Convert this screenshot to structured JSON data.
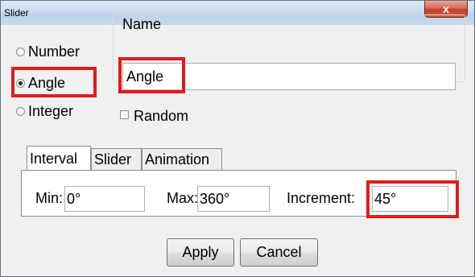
{
  "window": {
    "title": "Slider",
    "close_glyph": "x"
  },
  "type_options": [
    {
      "label": "Number",
      "selected": false
    },
    {
      "label": "Angle",
      "selected": true
    },
    {
      "label": "Integer",
      "selected": false
    }
  ],
  "name": {
    "label": "Name",
    "value": "Angle"
  },
  "random": {
    "label": "Random",
    "checked": false
  },
  "tabs": [
    "Interval",
    "Slider",
    "Animation"
  ],
  "active_tab": "Interval",
  "interval": {
    "min_label": "Min:",
    "min_value": "0°",
    "max_label": "Max:",
    "max_value": "360°",
    "increment_label": "Increment:",
    "increment_value": "45°"
  },
  "buttons": {
    "apply": "Apply",
    "cancel": "Cancel"
  },
  "colors": {
    "highlight": "#e01b1b",
    "close_button": "#c4412d",
    "dialog_bg": "#f0f0f0"
  }
}
